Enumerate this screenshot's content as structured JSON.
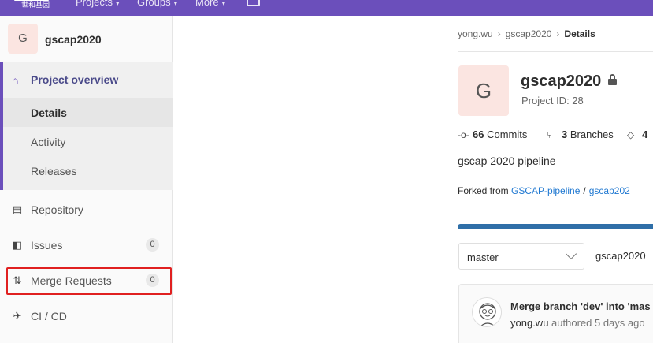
{
  "topbar": {
    "logo_text": "世和基因",
    "nav": [
      "Projects",
      "Groups",
      "More"
    ]
  },
  "sidebar": {
    "avatar_letter": "G",
    "project_name": "gscap2020",
    "overview_label": "Project overview",
    "overview_items": [
      "Details",
      "Activity",
      "Releases"
    ],
    "repository_label": "Repository",
    "issues_label": "Issues",
    "issues_count": "0",
    "merge_label": "Merge Requests",
    "merge_count": "0",
    "cicd_label": "CI / CD"
  },
  "breadcrumb": {
    "owner": "yong.wu",
    "project": "gscap2020",
    "current": "Details"
  },
  "project": {
    "avatar_letter": "G",
    "title": "gscap2020",
    "project_id": "Project ID: 28",
    "commits_count": "66",
    "commits_label": "Commits",
    "branches_count": "3",
    "branches_label": "Branches",
    "tags_count": "4",
    "description": "gscap 2020 pipeline",
    "forked_prefix": "Forked from",
    "forked_group": "GSCAP-pipeline",
    "forked_project": "gscap202",
    "language_progress": 1.0
  },
  "repo": {
    "branch": "master",
    "path": "gscap2020"
  },
  "commit": {
    "message": "Merge branch 'dev' into 'mas",
    "author": "yong.wu",
    "authored": "authored 5 days ago"
  },
  "colors": {
    "topbar": "#6b4fbb",
    "link": "#1f78d1",
    "highlight": "#e02020",
    "progress": "#2f6fa8"
  }
}
